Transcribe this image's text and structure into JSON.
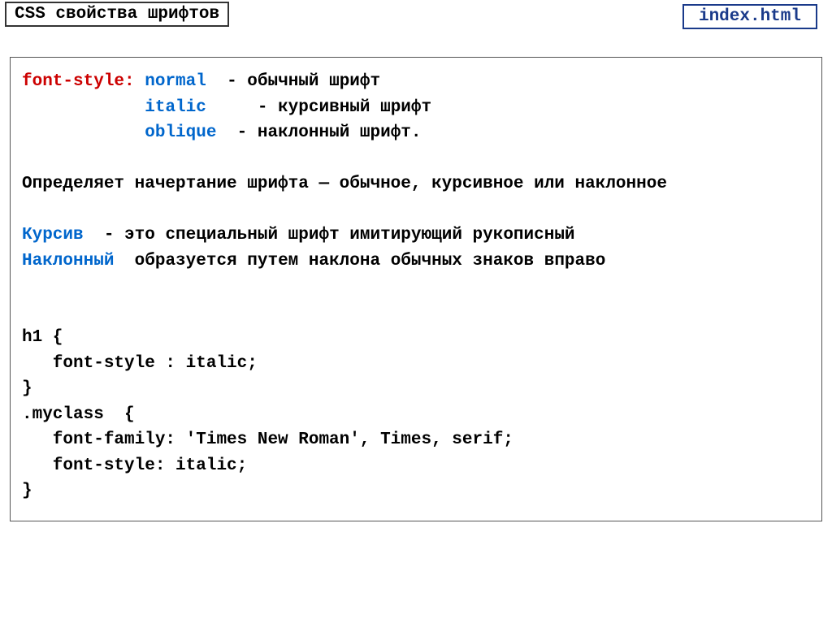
{
  "header": {
    "title": "CSS свойства шрифтов",
    "filename": "index.html"
  },
  "body": {
    "line1_prop": "font-style:",
    "line1_val": "normal",
    "line1_desc": "- обычный шрифт",
    "line2_val": "italic",
    "line2_desc": "- курсивный шрифт",
    "line3_val": "oblique",
    "line3_desc": "- наклонный шрифт.",
    "summary": "Определяет начертание шрифта — обычное, курсивное или наклонное",
    "term1": "Курсив",
    "term1_desc": "- это специальный шрифт имитирующий рукописный",
    "term2": "Наклонный",
    "term2_desc": "образуется путем наклона обычных знаков вправо",
    "code1": "h1 {",
    "code2": "   font-style : italic;",
    "code3": "}",
    "code4": ".myclass  {",
    "code5": "   font-family: 'Times New Roman', Times, serif;",
    "code6": "   font-style: italic;",
    "code7": "}"
  }
}
